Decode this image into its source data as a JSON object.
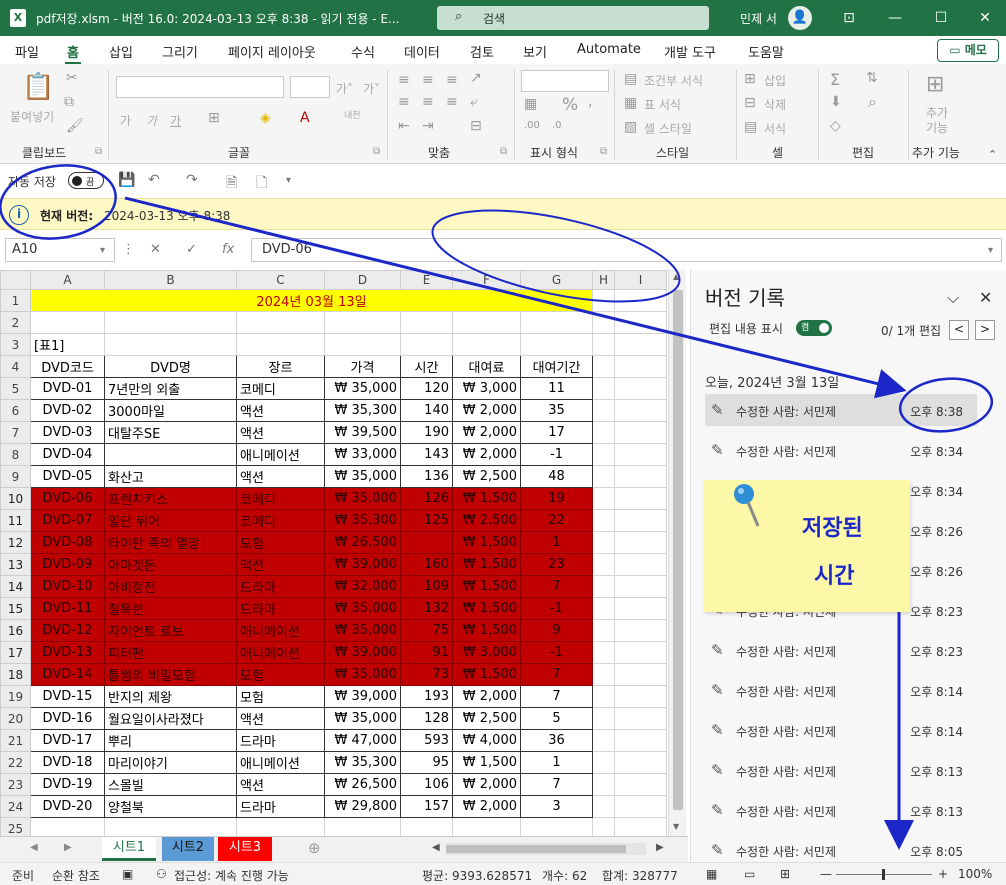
{
  "window": {
    "title": "pdf저장.xlsm  -  버전 16.0: 2024-03-13 오후 8:38  -  읽기 전용  -  E...",
    "search_placeholder": "검색",
    "user": "민제 서",
    "avatar": "👤"
  },
  "menu": {
    "tabs": [
      "파일",
      "홈",
      "삽입",
      "그리기",
      "페이지 레이아웃",
      "수식",
      "데이터",
      "검토",
      "보기",
      "Automate",
      "개발 도구",
      "도움말"
    ],
    "active": "홈",
    "memo": "메모"
  },
  "ribbon": {
    "groups": [
      "클립보드",
      "글꼴",
      "맞춤",
      "표시 형식",
      "스타일",
      "셀",
      "편집",
      "추가 기능"
    ],
    "paste": "붙여넣기",
    "font_size_up": "가˄",
    "font_size_down": "가˅",
    "bold": "가",
    "italic": "가",
    "underline": "가",
    "cond_format": "조건부 서식",
    "table_format": "표 서식",
    "cell_style": "셀 스타일",
    "insert": "삽입",
    "delete": "삭제",
    "format": "서식",
    "addins": "추가 기능",
    "addins_group": "추가 기능"
  },
  "qat": {
    "autosave_label": "자동 저장",
    "toggle_state": "끔"
  },
  "infobar": {
    "label": "현재 버전:",
    "value": "2024-03-13 오후 8:38"
  },
  "formula_bar": {
    "name_box": "A10",
    "formula": "DVD-06",
    "fx": "fx"
  },
  "sheet": {
    "columns": [
      "A",
      "B",
      "C",
      "D",
      "E",
      "F",
      "G",
      "H",
      "I"
    ],
    "title": "2024년 03월 13일",
    "table_label": "[표1]",
    "headers": [
      "DVD코드",
      "DVD명",
      "장르",
      "가격",
      "시간",
      "대여료",
      "대여기간"
    ],
    "rows": [
      [
        "DVD-01",
        "7년만의 외출",
        "코메디",
        "₩ 35,000",
        "120",
        "₩ 3,000",
        "11"
      ],
      [
        "DVD-02",
        "3000마일",
        "액션",
        "₩ 35,300",
        "140",
        "₩ 2,000",
        "35"
      ],
      [
        "DVD-03",
        "대탈주SE",
        "액션",
        "₩ 39,500",
        "190",
        "₩ 2,000",
        "17"
      ],
      [
        "DVD-04",
        "",
        "애니메이션",
        "₩ 33,000",
        "143",
        "₩ 2,000",
        "-1"
      ],
      [
        "DVD-05",
        "화산고",
        "액션",
        "₩ 35,000",
        "136",
        "₩ 2,500",
        "48"
      ],
      [
        "DVD-06",
        "프렌치키스",
        "코메디",
        "₩ 35,000",
        "126",
        "₩ 1,500",
        "19"
      ],
      [
        "DVD-07",
        "일단 뛰어",
        "코메디",
        "₩ 35,300",
        "125",
        "₩ 2,500",
        "22"
      ],
      [
        "DVD-08",
        "타이탄 족의 멸망",
        "모험",
        "₩ 26,500",
        "",
        "₩ 1,500",
        "1"
      ],
      [
        "DVD-09",
        "아마겟돈",
        "액션",
        "₩ 39,000",
        "160",
        "₩ 1,500",
        "23"
      ],
      [
        "DVD-10",
        "아비정전",
        "드라마",
        "₩ 32,000",
        "109",
        "₩ 1,500",
        "7"
      ],
      [
        "DVD-11",
        "철목련",
        "드라마",
        "₩ 35,000",
        "132",
        "₩ 1,500",
        "-1"
      ],
      [
        "DVD-12",
        "자이언트 로보",
        "애니메이션",
        "₩ 35,000",
        "75",
        "₩ 1,500",
        "9"
      ],
      [
        "DVD-13",
        "피터팬",
        "애니메이션",
        "₩ 39,000",
        "91",
        "₩ 3,000",
        "-1"
      ],
      [
        "DVD-14",
        "톰썸의 비밀모험",
        "모험",
        "₩ 35,000",
        "73",
        "₩ 1,500",
        "7"
      ],
      [
        "DVD-15",
        "반지의 제왕",
        "모험",
        "₩ 39,000",
        "193",
        "₩ 2,000",
        "7"
      ],
      [
        "DVD-16",
        "월요일이사라졌다",
        "액션",
        "₩ 35,000",
        "128",
        "₩ 2,500",
        "5"
      ],
      [
        "DVD-17",
        "뿌리",
        "드라마",
        "₩ 47,000",
        "593",
        "₩ 4,000",
        "36"
      ],
      [
        "DVD-18",
        "마리이야기",
        "애니메이션",
        "₩ 35,300",
        "95",
        "₩ 1,500",
        "1"
      ],
      [
        "DVD-19",
        "스몰빌",
        "액션",
        "₩ 26,500",
        "106",
        "₩ 2,000",
        "7"
      ],
      [
        "DVD-20",
        "양철북",
        "드라마",
        "₩ 29,800",
        "157",
        "₩ 2,000",
        "3"
      ]
    ],
    "row_numbers": [
      "1",
      "2",
      "3",
      "4",
      "5",
      "6",
      "7",
      "8",
      "9",
      "10",
      "11",
      "12",
      "13",
      "14",
      "15",
      "16",
      "17",
      "18",
      "19",
      "20",
      "21",
      "22",
      "23",
      "24",
      "25"
    ],
    "sheet_tabs": [
      "시트1",
      "시트2",
      "시트3"
    ]
  },
  "status": {
    "ready": "준비",
    "circular": "순환 참조",
    "accessibility": "접근성: 계속 진행 가능",
    "average": "평균: 9393.628571",
    "count": "개수: 62",
    "sum": "합계: 328777",
    "zoom": "100%"
  },
  "pane": {
    "title": "버전 기록",
    "show_edits": "편집 내용 표시",
    "toggle": "켬",
    "edit_count": "0/ 1개 편집",
    "date_header": "오늘, 2024년 3월 13일",
    "versions": [
      {
        "who": "수정한 사람: 서민제",
        "time": "오후 8:38"
      },
      {
        "who": "수정한 사람: 서민제",
        "time": "오후 8:34"
      },
      {
        "who": "",
        "time": "오후 8:34"
      },
      {
        "who": "",
        "time": "오후 8:26"
      },
      {
        "who": "",
        "time": "오후 8:26"
      },
      {
        "who": "수정한 사람: 서민제",
        "time": "오후 8:23"
      },
      {
        "who": "수정한 사람: 서민제",
        "time": "오후 8:23"
      },
      {
        "who": "수정한 사람: 서민제",
        "time": "오후 8:14"
      },
      {
        "who": "수정한 사람: 서민제",
        "time": "오후 8:14"
      },
      {
        "who": "수정한 사람: 서민제",
        "time": "오후 8:13"
      },
      {
        "who": "수정한 사람: 서민제",
        "time": "오후 8:13"
      },
      {
        "who": "수정한 사람: 서민제",
        "time": "오후 8:05"
      }
    ]
  },
  "annotation": {
    "note_line1": "저장된",
    "note_line2": "시간",
    "ink_color": "#1b27c8"
  },
  "colors": {
    "brand": "#217346",
    "highlight_row": "#c00000",
    "title_fill": "#ffff00",
    "title_text": "#c00000",
    "tab2": "#5b9bd5",
    "tab3": "#ff0000"
  }
}
